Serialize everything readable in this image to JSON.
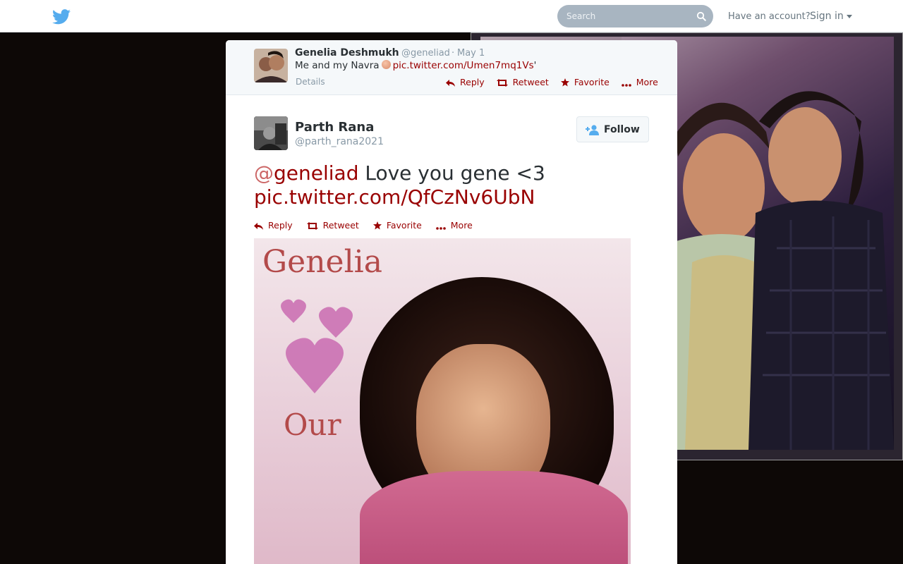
{
  "nav": {
    "search_placeholder": "Search",
    "have_account": "Have an account?",
    "sign_in": "Sign in"
  },
  "ancestor_tweet": {
    "name": "Genelia Deshmukh",
    "handle": "@geneliad",
    "separator": "·",
    "date": "May 1",
    "text_before": "Me and my Navra",
    "link": "pic.twitter.com/Umen7mq1Vs",
    "text_after": "'",
    "details": "Details",
    "actions": [
      "Reply",
      "Retweet",
      "Favorite",
      "More"
    ]
  },
  "main_tweet": {
    "name": "Parth Rana",
    "handle": "@parth_rana2021",
    "follow_label": "Follow",
    "mention_at": "@",
    "mention": "geneliad",
    "text": " Love you gene <3",
    "link": "pic.twitter.com/QfCzNv6UbN",
    "actions": [
      "Reply",
      "Retweet",
      "Favorite",
      "More"
    ],
    "media_words": [
      "Genelia",
      "Our"
    ]
  },
  "colors": {
    "link": "#990000",
    "bird": "#55acee",
    "search_bg": "#a8b5c1",
    "page_bg": "#0d0806"
  }
}
